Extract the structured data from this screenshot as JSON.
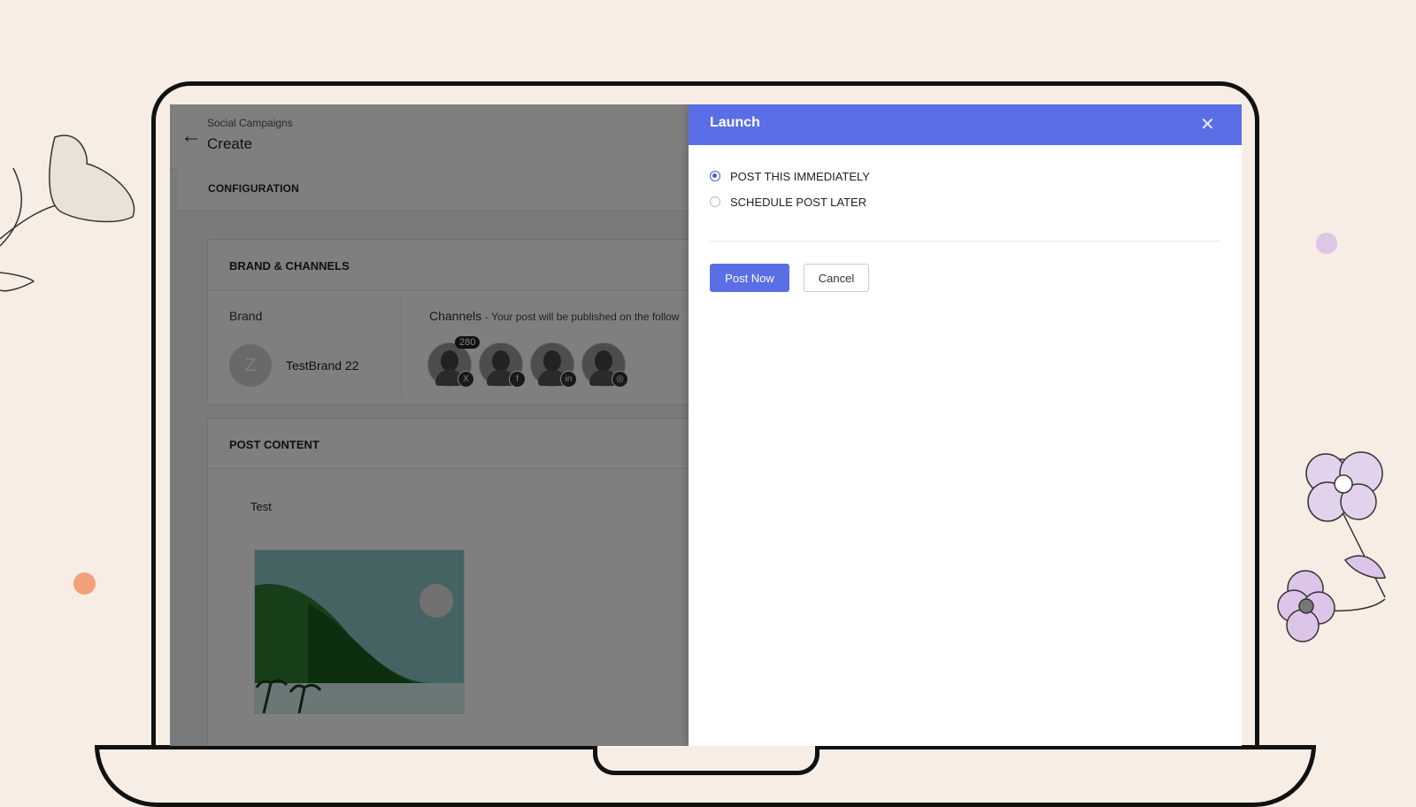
{
  "app": {
    "breadcrumb": "Social Campaigns",
    "title": "Create",
    "config_label": "CONFIGURATION"
  },
  "brand_channels": {
    "section_title": "BRAND & CHANNELS",
    "brand_label": "Brand",
    "brand_initial": "Z",
    "brand_name": "TestBrand 22",
    "channels_label": "Channels",
    "channels_note": "- Your post will be published on the follow",
    "channels": [
      {
        "network": "x",
        "badge_glyph": "X",
        "count": "280"
      },
      {
        "network": "facebook",
        "badge_glyph": "f"
      },
      {
        "network": "linkedin",
        "badge_glyph": "in"
      },
      {
        "network": "instagram",
        "badge_glyph": "◎"
      }
    ]
  },
  "post_content": {
    "section_title": "POST CONTENT",
    "text": "Test"
  },
  "dialog": {
    "title": "Launch",
    "close_glyph": "✕",
    "options": [
      {
        "label": "POST THIS IMMEDIATELY",
        "checked": true
      },
      {
        "label": "SCHEDULE POST LATER",
        "checked": false
      }
    ],
    "primary_button": "Post Now",
    "secondary_button": "Cancel"
  },
  "colors": {
    "accent": "#5a6ee5",
    "page_background": "#f7ede4"
  }
}
